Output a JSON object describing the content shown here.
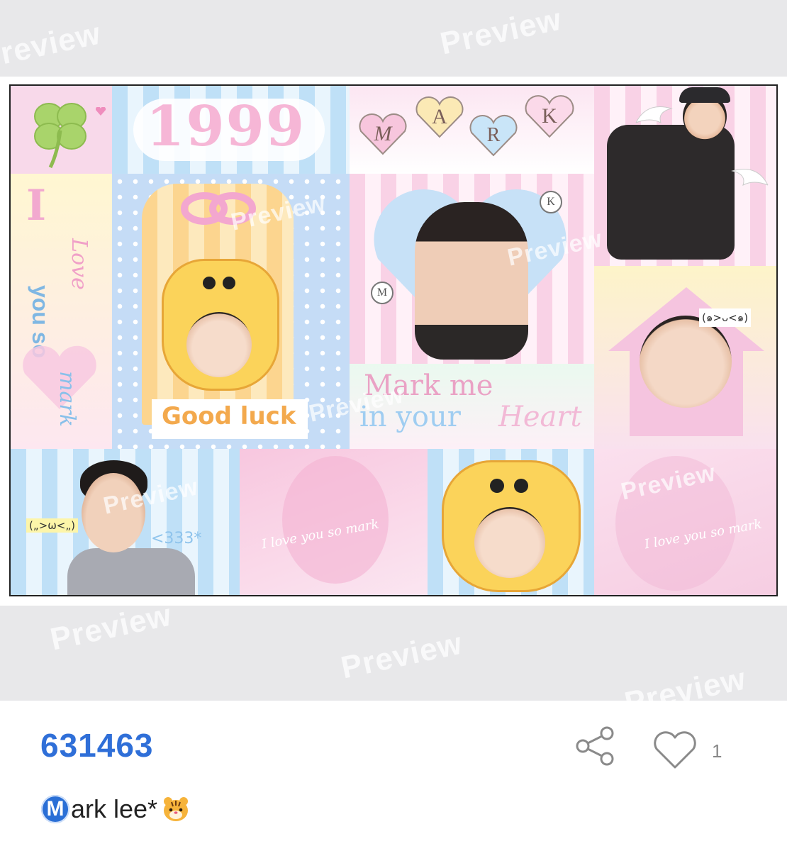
{
  "preview": {
    "watermark_text": "Preview",
    "collage": {
      "tile_1999": "1999",
      "hearts_letters": [
        "M",
        "A",
        "R",
        "K"
      ],
      "side_text_i": "I",
      "side_text_love": "Love",
      "side_text_you_so": "you so",
      "side_text_mark": "mark",
      "good_luck": "Good luck",
      "mark_me": "Mark me",
      "in_your": "in your",
      "heart_word": "Heart",
      "kaomoji_1": "(๑>ᴗ<๑)",
      "kaomoji_2": "(„>ω<„)",
      "less_333": "<333*",
      "circle_m": "M",
      "circle_k": "K",
      "script_love_1": "I love you so mark",
      "script_love_2": "I love you so mark"
    }
  },
  "post": {
    "id": "631463",
    "title_badge": "M",
    "title_text": "ark lee*",
    "like_count": "1"
  },
  "icons": {
    "share": "share-icon",
    "like": "heart-outline-icon",
    "tiger": "tiger-emoji-icon",
    "clover": "clover-icon"
  },
  "colors": {
    "id_blue": "#2f6fd8",
    "badge_blue": "#2a6fd6",
    "preview_bg": "#e8e8ea",
    "icon_gray": "#8a8a8a"
  }
}
